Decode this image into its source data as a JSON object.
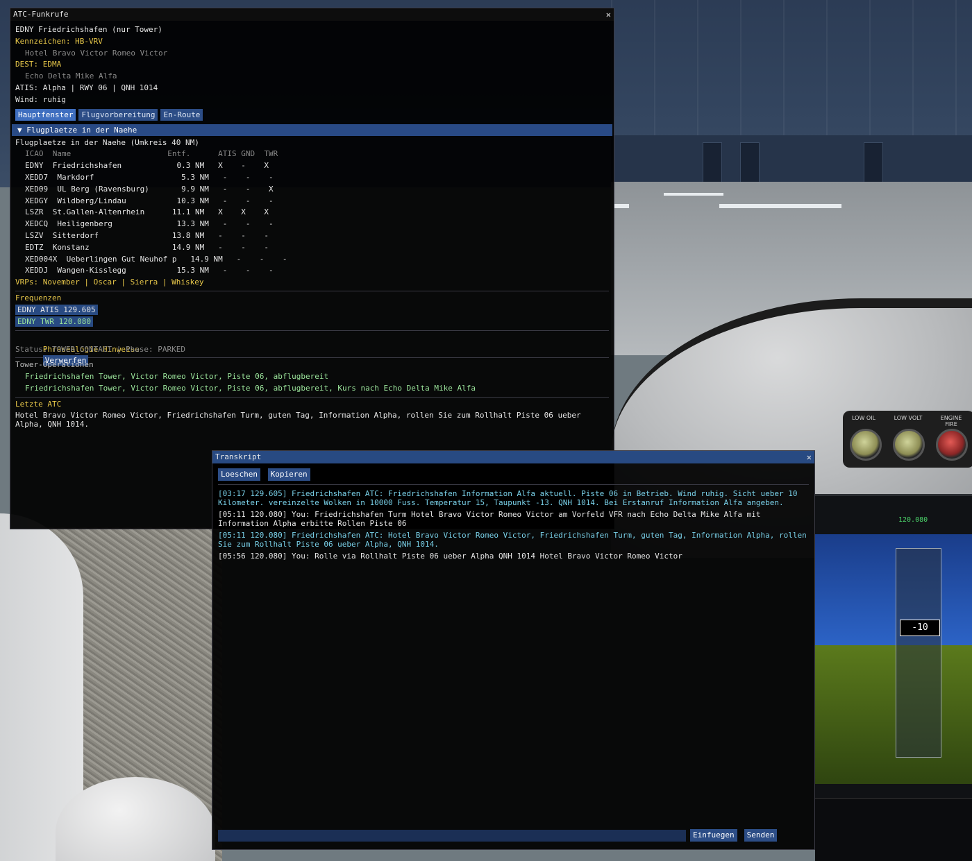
{
  "main_window": {
    "title": "ATC-Funkrufe",
    "airport_line": "EDNY Friedrichshafen (nur Tower)",
    "callsign_label": "Kennzeichen: HB-VRV",
    "callsign_spoken": "Hotel Bravo Victor Romeo Victor",
    "dest_label": "DEST: EDMA",
    "dest_spoken": "Echo Delta Mike Alfa",
    "atis_line": "ATIS: Alpha | RWY 06 | QNH 1014",
    "wind_line": "Wind: ruhig",
    "tabs": [
      {
        "label": "Hauptfenster"
      },
      {
        "label": "Flugvorbereitung"
      },
      {
        "label": "En-Route"
      }
    ],
    "section_header": "▼  Flugplaetze in der Naehe",
    "nearby_title": "Flugplaetze in der Naehe (Umkreis 40 NM)",
    "table_header": "ICAO  Name                     Entf.      ATIS GND  TWR",
    "airports": [
      "EDNY  Friedrichshafen            0.3 NM   X    -    X",
      "XEDD7  Markdorf                   5.3 NM   -    -    -",
      "XED09  UL Berg (Ravensburg)       9.9 NM   -    -    X",
      "XEDGY  Wildberg/Lindau           10.3 NM   -    -    -",
      "LSZR  St.Gallen-Altenrhein      11.1 NM   X    X    X",
      "XEDCQ  Heiligenberg              13.3 NM   -    -    -",
      "LSZV  Sitterdorf                13.8 NM   -    -    -",
      "EDTZ  Konstanz                  14.9 NM   -    -    -",
      "XED004X  Ueberlingen Gut Neuhof p   14.9 NM   -    -    -",
      "XEDDJ  Wangen-Kisslegg           15.3 NM   -    -    -"
    ],
    "vrps_line": "VRPs: November | Oscar | Sierra | Whiskey",
    "frequencies_title": "Frequenzen",
    "frequencies": [
      {
        "label": "EDNY ATIS   129.605",
        "active": false
      },
      {
        "label": "EDNY TWR    120.080",
        "active": true
      }
    ],
    "phraseology_title": "Phraseologie-Hinweise",
    "discard_button": "Verwerfen",
    "status_line": "Status: TOWER_CONTACT | Phase: PARKED",
    "tower_ops_title": "Tower-Operationen",
    "tower_ops": [
      "Friedrichshafen Tower, Victor Romeo Victor, Piste 06, abflugbereit",
      "Friedrichshafen Tower, Victor Romeo Victor, Piste 06, abflugbereit, Kurs nach Echo Delta Mike Alfa"
    ],
    "last_atc_title": "Letzte ATC",
    "last_atc_text": "Hotel Bravo Victor Romeo Victor, Friedrichshafen Turm, guten Tag, Information Alpha, rollen Sie zum Rollhalt Piste 06 ueber Alpha, QNH 1014."
  },
  "transcript_window": {
    "title": "Transkript",
    "clear_button": "Loeschen",
    "copy_button": "Kopieren",
    "entries": [
      {
        "text": "[03:17 129.605] Friedrichshafen ATC: Friedrichshafen Information Alfa aktuell. Piste 06 in Betrieb. Wind ruhig. Sicht ueber 10 Kilometer. vereinzelte Wolken in 10000 Fuss. Temperatur 15, Taupunkt -13. QNH 1014. Bei Erstanruf Information Alfa angeben.",
        "kind": "atc"
      },
      {
        "text": "[05:11 120.080] You: Friedrichshafen Turm Hotel Bravo Victor Romeo Victor am Vorfeld VFR nach Echo Delta Mike Alfa mit Information Alpha erbitte Rollen Piste 06",
        "kind": "you"
      },
      {
        "text": "[05:11 120.080] Friedrichshafen ATC: Hotel Bravo Victor Romeo Victor, Friedrichshafen Turm, guten Tag, Information Alpha, rollen Sie zum Rollhalt Piste 06 ueber Alpha, QNH 1014.",
        "kind": "atc"
      },
      {
        "text": "[05:56 120.080] You: Rolle via Rollhalt Piste 06 ueber Alpha QNH 1014 Hotel Bravo Victor Romeo Victor",
        "kind": "you"
      }
    ],
    "input_value": "",
    "insert_button": "Einfuegen",
    "send_button": "Senden"
  },
  "cockpit": {
    "warning_lights": [
      "LOW OIL",
      "LOW VOLT",
      "ENGINE FIRE"
    ],
    "pfd_altitude_readout": "-10",
    "pfd_frequency_readout": "120.080"
  },
  "colors": {
    "atc_text": "#79d0e8",
    "you_text": "#e6e6e6",
    "accent": "#284a82",
    "highlight_yellow": "#e8c84a",
    "freq_active": "#9ce59c"
  }
}
